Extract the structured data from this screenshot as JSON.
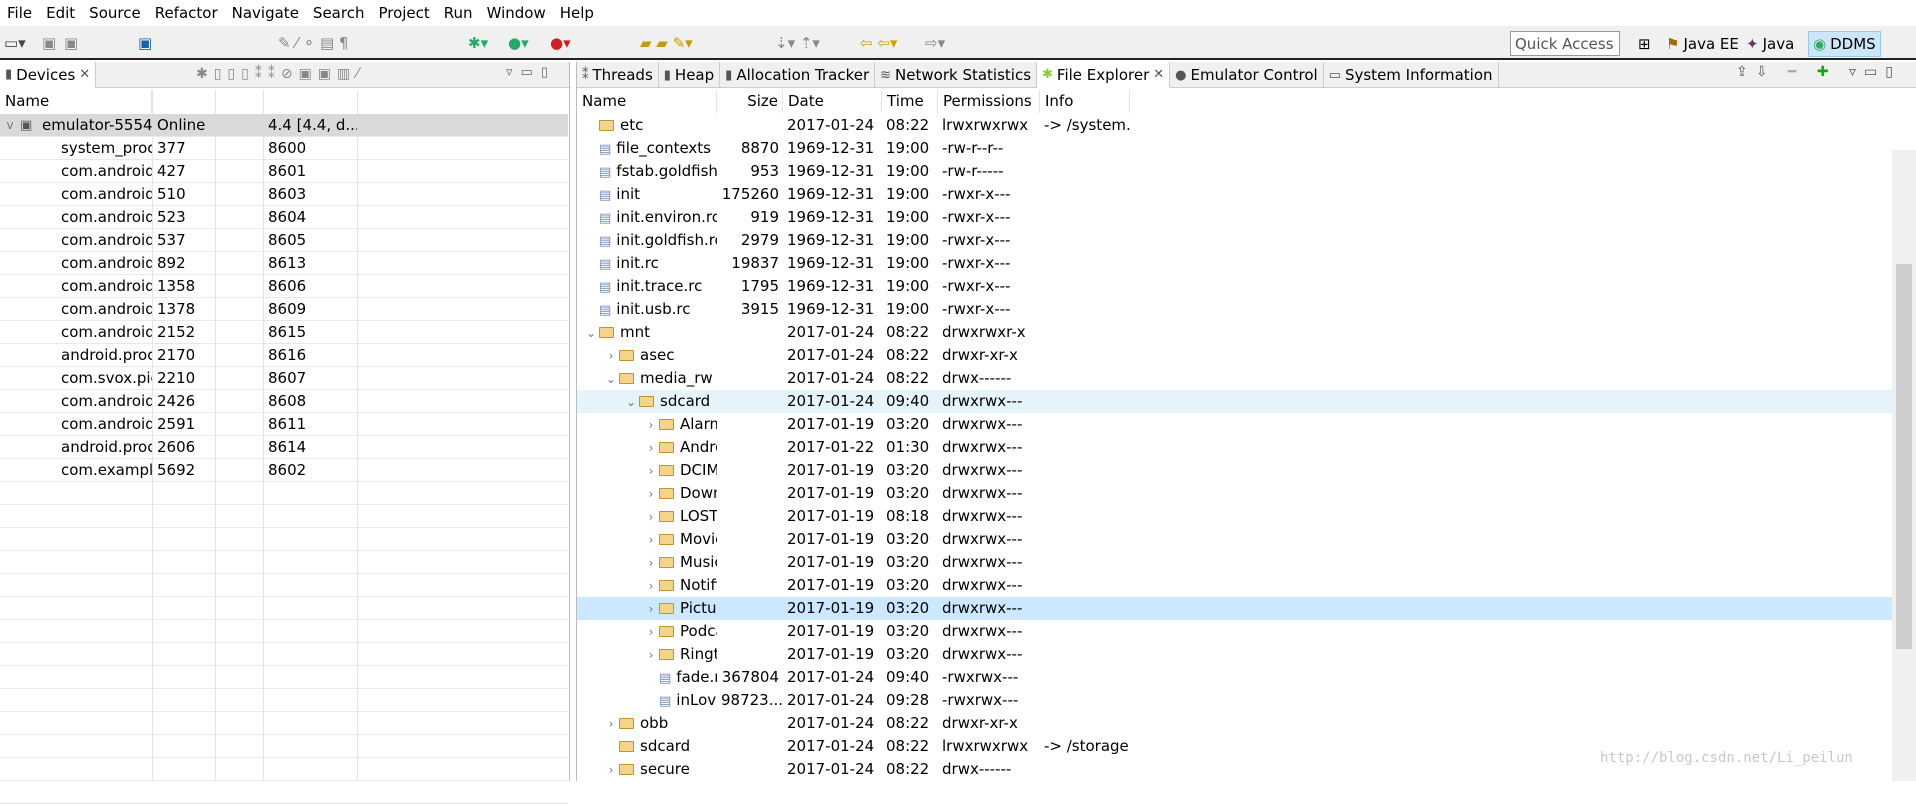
{
  "menu": [
    "File",
    "Edit",
    "Source",
    "Refactor",
    "Navigate",
    "Search",
    "Project",
    "Run",
    "Window",
    "Help"
  ],
  "quick_access": "Quick Access",
  "perspectives": [
    {
      "label": "Java EE"
    },
    {
      "label": "Java"
    },
    {
      "label": "DDMS",
      "active": true
    }
  ],
  "devices": {
    "tab": "Devices",
    "columns": [
      "Name",
      "",
      "",
      "",
      ""
    ],
    "device": {
      "name": "emulator-5554",
      "status": "Online",
      "version": "4.4 [4.4, d..."
    },
    "processes": [
      [
        "system_proc",
        "377",
        "8600"
      ],
      [
        "com.android",
        "427",
        "8601"
      ],
      [
        "com.android",
        "510",
        "8603"
      ],
      [
        "com.android",
        "523",
        "8604"
      ],
      [
        "com.android",
        "537",
        "8605"
      ],
      [
        "com.android",
        "892",
        "8613"
      ],
      [
        "com.android",
        "1358",
        "8606"
      ],
      [
        "com.android",
        "1378",
        "8609"
      ],
      [
        "com.android",
        "2152",
        "8615"
      ],
      [
        "android.proc",
        "2170",
        "8616"
      ],
      [
        "com.svox.pic",
        "2210",
        "8607"
      ],
      [
        "com.android",
        "2426",
        "8608"
      ],
      [
        "com.android",
        "2591",
        "8611"
      ],
      [
        "android.proc",
        "2606",
        "8614"
      ],
      [
        "com.exampl",
        "5692",
        "8602"
      ]
    ]
  },
  "explorer": {
    "tabs": [
      "Threads",
      "Heap",
      "Allocation Tracker",
      "Network Statistics",
      "File Explorer",
      "Emulator Control",
      "System Information"
    ],
    "active_tab": "File Explorer",
    "columns": {
      "name": "Name",
      "size": "Size",
      "date": "Date",
      "time": "Time",
      "perm": "Permissions",
      "info": "Info"
    },
    "rows": [
      {
        "level": 0,
        "type": "folder",
        "twisty": "",
        "name": "etc",
        "size": "",
        "date": "2017-01-24",
        "time": "08:22",
        "perm": "lrwxrwxrwx",
        "info": "-> /system..."
      },
      {
        "level": 0,
        "type": "file",
        "twisty": "",
        "name": "file_contexts",
        "size": "8870",
        "date": "1969-12-31",
        "time": "19:00",
        "perm": "-rw-r--r--",
        "info": ""
      },
      {
        "level": 0,
        "type": "file",
        "twisty": "",
        "name": "fstab.goldfish",
        "size": "953",
        "date": "1969-12-31",
        "time": "19:00",
        "perm": "-rw-r-----",
        "info": ""
      },
      {
        "level": 0,
        "type": "file",
        "twisty": "",
        "name": "init",
        "size": "175260",
        "date": "1969-12-31",
        "time": "19:00",
        "perm": "-rwxr-x---",
        "info": ""
      },
      {
        "level": 0,
        "type": "file",
        "twisty": "",
        "name": "init.environ.rc",
        "size": "919",
        "date": "1969-12-31",
        "time": "19:00",
        "perm": "-rwxr-x---",
        "info": ""
      },
      {
        "level": 0,
        "type": "file",
        "twisty": "",
        "name": "init.goldfish.rc",
        "size": "2979",
        "date": "1969-12-31",
        "time": "19:00",
        "perm": "-rwxr-x---",
        "info": ""
      },
      {
        "level": 0,
        "type": "file",
        "twisty": "",
        "name": "init.rc",
        "size": "19837",
        "date": "1969-12-31",
        "time": "19:00",
        "perm": "-rwxr-x---",
        "info": ""
      },
      {
        "level": 0,
        "type": "file",
        "twisty": "",
        "name": "init.trace.rc",
        "size": "1795",
        "date": "1969-12-31",
        "time": "19:00",
        "perm": "-rwxr-x---",
        "info": ""
      },
      {
        "level": 0,
        "type": "file",
        "twisty": "",
        "name": "init.usb.rc",
        "size": "3915",
        "date": "1969-12-31",
        "time": "19:00",
        "perm": "-rwxr-x---",
        "info": ""
      },
      {
        "level": 0,
        "type": "folder",
        "twisty": "v",
        "name": "mnt",
        "size": "",
        "date": "2017-01-24",
        "time": "08:22",
        "perm": "drwxrwxr-x",
        "info": ""
      },
      {
        "level": 1,
        "type": "folder",
        "twisty": ">",
        "name": "asec",
        "size": "",
        "date": "2017-01-24",
        "time": "08:22",
        "perm": "drwxr-xr-x",
        "info": ""
      },
      {
        "level": 1,
        "type": "folder",
        "twisty": "v",
        "name": "media_rw",
        "size": "",
        "date": "2017-01-24",
        "time": "08:22",
        "perm": "drwx------",
        "info": ""
      },
      {
        "level": 2,
        "type": "folder",
        "twisty": "v",
        "name": "sdcard",
        "size": "",
        "date": "2017-01-24",
        "time": "09:40",
        "perm": "drwxrwx---",
        "info": "",
        "state": "hover"
      },
      {
        "level": 3,
        "type": "folder",
        "twisty": ">",
        "name": "Alarm",
        "size": "",
        "date": "2017-01-19",
        "time": "03:20",
        "perm": "drwxrwx---",
        "info": ""
      },
      {
        "level": 3,
        "type": "folder",
        "twisty": ">",
        "name": "Andro",
        "size": "",
        "date": "2017-01-22",
        "time": "01:30",
        "perm": "drwxrwx---",
        "info": ""
      },
      {
        "level": 3,
        "type": "folder",
        "twisty": ">",
        "name": "DCIM",
        "size": "",
        "date": "2017-01-19",
        "time": "03:20",
        "perm": "drwxrwx---",
        "info": ""
      },
      {
        "level": 3,
        "type": "folder",
        "twisty": ">",
        "name": "Down",
        "size": "",
        "date": "2017-01-19",
        "time": "03:20",
        "perm": "drwxrwx---",
        "info": ""
      },
      {
        "level": 3,
        "type": "folder",
        "twisty": ">",
        "name": "LOST.",
        "size": "",
        "date": "2017-01-19",
        "time": "08:18",
        "perm": "drwxrwx---",
        "info": ""
      },
      {
        "level": 3,
        "type": "folder",
        "twisty": ">",
        "name": "Movie",
        "size": "",
        "date": "2017-01-19",
        "time": "03:20",
        "perm": "drwxrwx---",
        "info": ""
      },
      {
        "level": 3,
        "type": "folder",
        "twisty": ">",
        "name": "Music",
        "size": "",
        "date": "2017-01-19",
        "time": "03:20",
        "perm": "drwxrwx---",
        "info": ""
      },
      {
        "level": 3,
        "type": "folder",
        "twisty": ">",
        "name": "Notifi",
        "size": "",
        "date": "2017-01-19",
        "time": "03:20",
        "perm": "drwxrwx---",
        "info": ""
      },
      {
        "level": 3,
        "type": "folder",
        "twisty": ">",
        "name": "Pictur",
        "size": "",
        "date": "2017-01-19",
        "time": "03:20",
        "perm": "drwxrwx---",
        "info": "",
        "state": "selected"
      },
      {
        "level": 3,
        "type": "folder",
        "twisty": ">",
        "name": "Podca",
        "size": "",
        "date": "2017-01-19",
        "time": "03:20",
        "perm": "drwxrwx---",
        "info": ""
      },
      {
        "level": 3,
        "type": "folder",
        "twisty": ">",
        "name": "Ringt",
        "size": "",
        "date": "2017-01-19",
        "time": "03:20",
        "perm": "drwxrwx---",
        "info": ""
      },
      {
        "level": 3,
        "type": "file",
        "twisty": "",
        "name": "fade.r",
        "size": "367804",
        "date": "2017-01-24",
        "time": "09:40",
        "perm": "-rwxrwx---",
        "info": ""
      },
      {
        "level": 3,
        "type": "file",
        "twisty": "",
        "name": "inLov",
        "size": "98723...",
        "date": "2017-01-24",
        "time": "09:28",
        "perm": "-rwxrwx---",
        "info": ""
      },
      {
        "level": 1,
        "type": "folder",
        "twisty": ">",
        "name": "obb",
        "size": "",
        "date": "2017-01-24",
        "time": "08:22",
        "perm": "drwxr-xr-x",
        "info": ""
      },
      {
        "level": 1,
        "type": "folder",
        "twisty": "",
        "name": "sdcard",
        "size": "",
        "date": "2017-01-24",
        "time": "08:22",
        "perm": "lrwxrwxrwx",
        "info": "-> /storage..."
      },
      {
        "level": 1,
        "type": "folder",
        "twisty": ">",
        "name": "secure",
        "size": "",
        "date": "2017-01-24",
        "time": "08:22",
        "perm": "drwx------",
        "info": ""
      }
    ]
  },
  "colors": {
    "hover": "#e5f3fb",
    "selected": "#cce8ff",
    "device_row": "#d9d9d9"
  },
  "watermark": "http://blog.csdn.net/Li_peilun"
}
